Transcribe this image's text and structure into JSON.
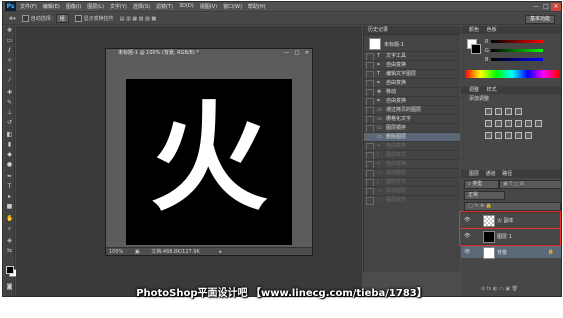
{
  "app": {
    "logo": "Ps",
    "menu": [
      "文件(F)",
      "编辑(E)",
      "图像(I)",
      "图层(L)",
      "文字(Y)",
      "选择(S)",
      "滤镜(T)",
      "3D(D)",
      "视图(V)",
      "窗口(W)",
      "帮助(H)"
    ],
    "window_controls": [
      "—",
      "□",
      "×"
    ]
  },
  "options_bar": {
    "auto_select_label": "自动选择：",
    "auto_select_value": "组",
    "transform_label": "显示变换控件",
    "workspace": "基本功能"
  },
  "document": {
    "title": "未标题-1 @ 100% (背景, RGB/8) *",
    "zoom": "100%",
    "doc_info": "文档:468.8K/127.9K",
    "art_char": "火"
  },
  "history": {
    "tabs": [
      "历史记录"
    ],
    "snapshot": "未标题-1",
    "steps": [
      "文字工具",
      "自由变换",
      "编辑文字图层",
      "自由变换",
      "移动",
      "自由变换",
      "通过拷贝的图层",
      "栅格化文字",
      "图层顺序",
      "删除图层"
    ],
    "ghost_steps": [
      "自由变换",
      "图层样式",
      "自由变换",
      "添加图层",
      "图层样式",
      "添加图层",
      "图层属性"
    ]
  },
  "color_panel": {
    "tabs": [
      "颜色",
      "色板"
    ],
    "channels": [
      "R",
      "G",
      "B"
    ]
  },
  "adjustments": {
    "tabs": [
      "调整",
      "样式"
    ],
    "title": "添加调整"
  },
  "layers": {
    "tabs": [
      "图层",
      "通道",
      "路径"
    ],
    "kind_label": "类型",
    "blend_mode": "正常",
    "items": [
      {
        "name": "火 副本",
        "thumb": "transparent",
        "highlighted": true
      },
      {
        "name": "图层 1",
        "thumb": "black",
        "highlighted": true
      },
      {
        "name": "背景",
        "thumb": "white",
        "selected": true
      }
    ]
  },
  "footer": "PhotoShop平面设计吧 【www.linecg.com/tieba/1783】",
  "colors": {
    "highlight_box": "#e0312f",
    "selected_row": "#5a6878",
    "ps_blue": "#3fb4ff"
  }
}
